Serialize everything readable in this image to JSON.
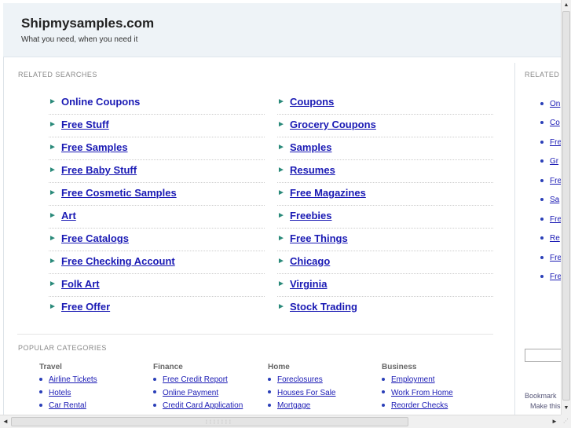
{
  "header": {
    "site_title": "Shipmysamples.com",
    "tagline": "What you need, when you need it"
  },
  "main": {
    "related_label": "RELATED SEARCHES",
    "left_searches": [
      "Online Coupons",
      "Free Stuff",
      "Free Samples",
      "Free Baby Stuff",
      "Free Cosmetic Samples",
      "Art",
      "Free Catalogs",
      "Free Checking Account",
      "Folk Art",
      "Free Offer"
    ],
    "right_searches": [
      "Coupons",
      "Grocery Coupons",
      "Samples",
      "Resumes",
      "Free Magazines",
      "Freebies",
      "Free Things",
      "Chicago",
      "Virginia",
      "Stock Trading"
    ],
    "popular_label": "POPULAR CATEGORIES",
    "categories": [
      {
        "title": "Travel",
        "items": [
          "Airline Tickets",
          "Hotels",
          "Car Rental"
        ]
      },
      {
        "title": "Finance",
        "items": [
          "Free Credit Report",
          "Online Payment",
          "Credit Card Application"
        ]
      },
      {
        "title": "Home",
        "items": [
          "Foreclosures",
          "Houses For Sale",
          "Mortgage"
        ]
      },
      {
        "title": "Business",
        "items": [
          "Employment",
          "Work From Home",
          "Reorder Checks"
        ]
      }
    ]
  },
  "right_panel": {
    "label": "RELATED",
    "items": [
      "On",
      "Co",
      "Fre",
      "Gr",
      "Fre",
      "Sa",
      "Fre",
      "Re",
      "Fre",
      "Fre"
    ],
    "bookmark_text": "Bookmark",
    "make_text": "Make this"
  },
  "icons": {
    "arrow": "►",
    "scroll_up": "▲",
    "scroll_down": "▼",
    "scroll_left": "◄",
    "scroll_right": "►",
    "grip": "⋮⋮⋮⋮⋮⋮⋮",
    "resize": "⋰"
  },
  "colors": {
    "link": "#1a1ab4",
    "arrow": "#2a8a7a",
    "header_bg": "#eef3f7"
  }
}
